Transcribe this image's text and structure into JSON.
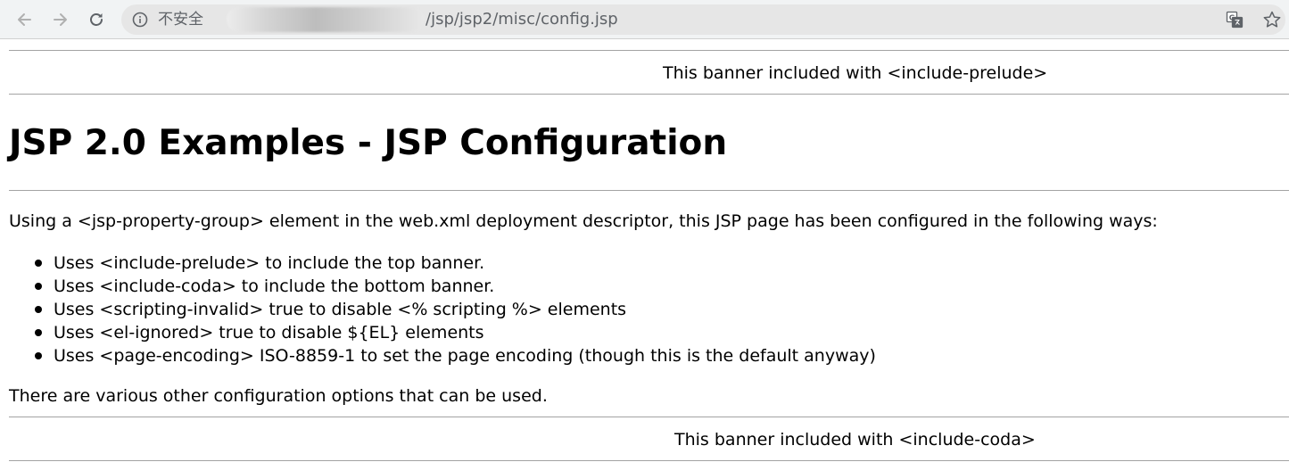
{
  "browser": {
    "security_label": "不安全",
    "url_path": "/jsp/jsp2/misc/config.jsp",
    "icons": {
      "back": "arrow-left-icon",
      "forward": "arrow-right-icon",
      "reload": "reload-icon",
      "info": "info-icon",
      "translate": "translate-icon",
      "bookmark": "star-icon"
    }
  },
  "page": {
    "top_banner": "This banner included with <include-prelude>",
    "title": "JSP 2.0 Examples - JSP Configuration",
    "intro": "Using a <jsp-property-group> element in the web.xml deployment descriptor, this JSP page has been configured in the following ways:",
    "features": [
      "Uses <include-prelude> to include the top banner.",
      "Uses <include-coda> to include the bottom banner.",
      "Uses <scripting-invalid> true to disable <% scripting %> elements",
      "Uses <el-ignored> true to disable ${EL} elements",
      "Uses <page-encoding> ISO-8859-1 to set the page encoding (though this is the default anyway)"
    ],
    "outro": "There are various other configuration options that can be used.",
    "bottom_banner": "This banner included with <include-coda>"
  },
  "colors": {
    "toolbar_bg": "#f1f3f4",
    "omnibox_bg": "#e6e6e6",
    "toolbar_icon": "#5f6368",
    "rule": "#a3a3a3",
    "text": "#000000"
  }
}
